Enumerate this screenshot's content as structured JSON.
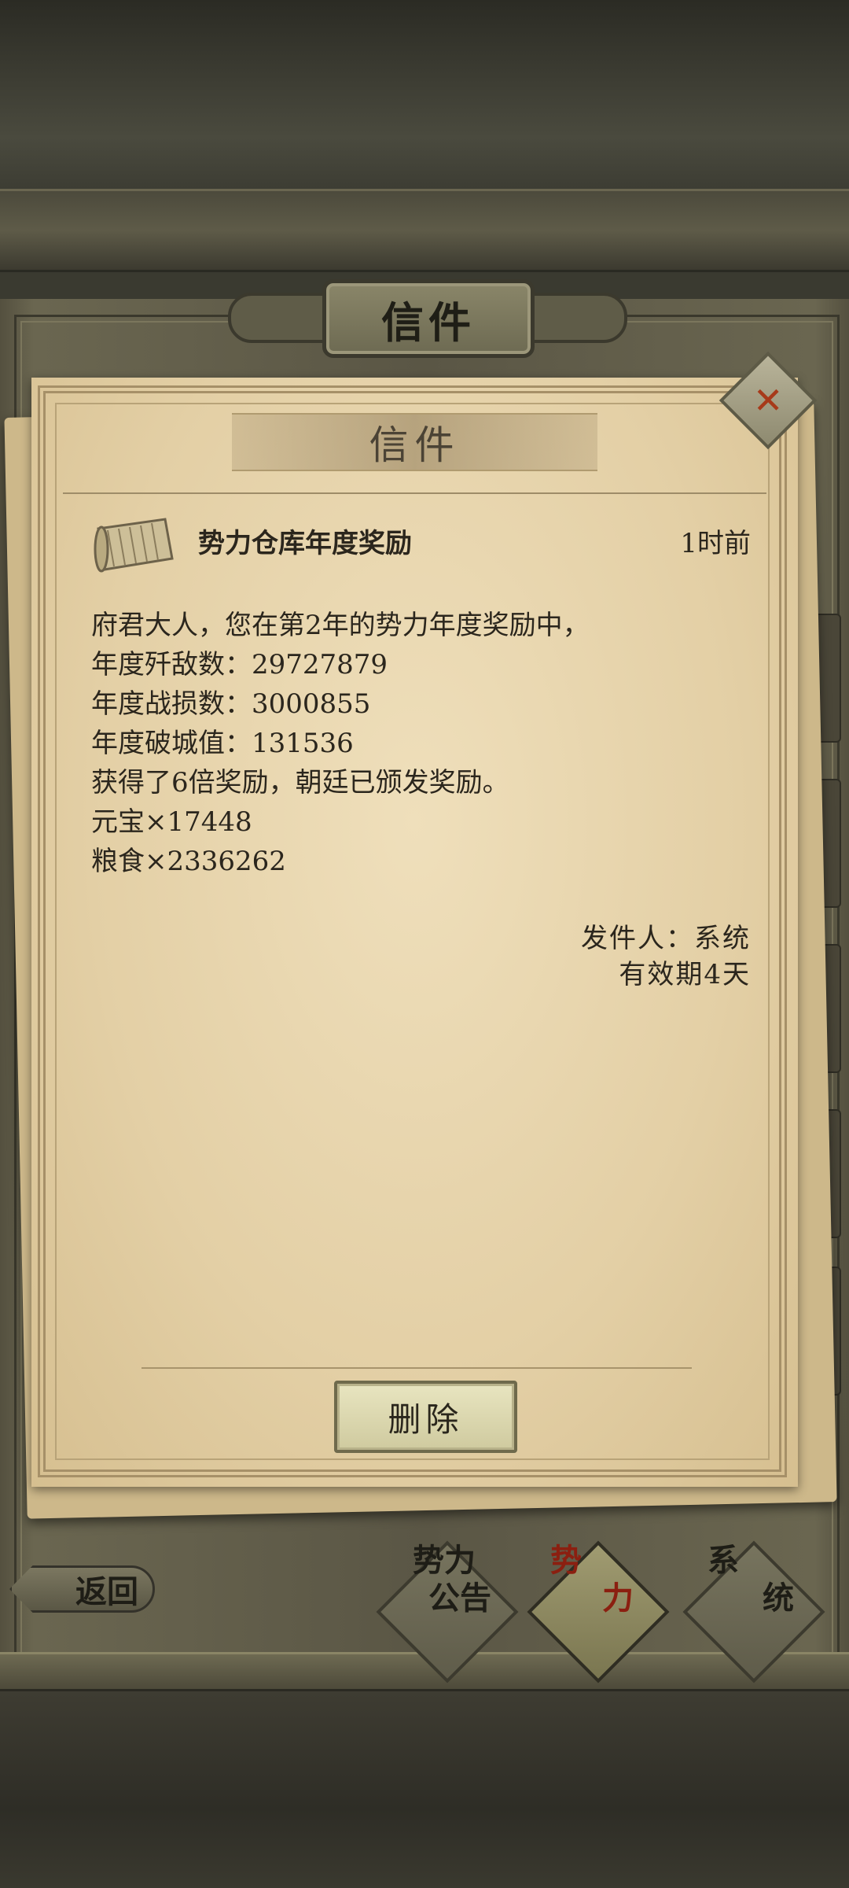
{
  "header": {
    "title": "信件"
  },
  "panel": {
    "title": "信件",
    "close_icon": "close-x-icon"
  },
  "mail": {
    "icon": "scroll-icon",
    "subject": "势力仓库年度奖励",
    "time_ago": "1时前",
    "body": [
      "府君大人，您在第2年的势力年度奖励中，",
      "年度歼敌数：29727879",
      "年度战损数：3000855",
      "年度破城值：131536",
      "获得了6倍奖励，朝廷已颁发奖励。",
      "元宝×17448",
      "粮食×2336262"
    ],
    "sender": "发件人：系统",
    "validity": "有效期4天",
    "delete_label": "删除"
  },
  "nav": {
    "back_label": "返回",
    "tabs": [
      {
        "label_line1": "势力",
        "label_line2": "公告",
        "active": false
      },
      {
        "label_line1": "势",
        "label_line2": "力",
        "active": true
      },
      {
        "label_line1": "系",
        "label_line2": "统",
        "active": false
      }
    ]
  },
  "colors": {
    "active_tab_text": "#8b1f10",
    "tab_text": "#1e1d16",
    "close_icon": "#a73a1a"
  }
}
